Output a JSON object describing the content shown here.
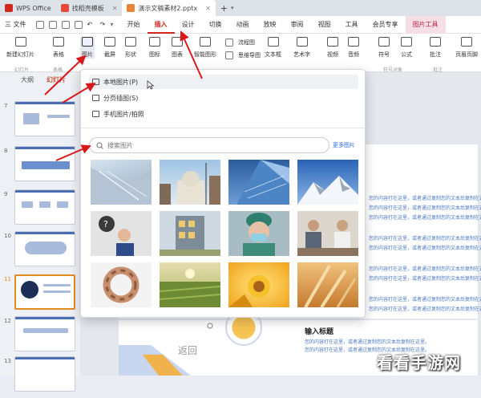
{
  "titlebar": {
    "tabs": [
      {
        "label": "WPS Office",
        "color": "#d0261d"
      },
      {
        "label": "找稻壳模板",
        "color": "#e8483b"
      },
      {
        "label": "演示文稿素材2.pptx",
        "color": "#e8833a"
      }
    ],
    "new_tab": "+"
  },
  "menubar": {
    "file": "三 文件",
    "items": [
      "开始",
      "插入",
      "设计",
      "切换",
      "动画",
      "放映",
      "审阅",
      "视图",
      "工具",
      "会员专享",
      "图片工具"
    ],
    "active": "插入"
  },
  "ribbon": {
    "buttons": [
      {
        "label": "新建幻灯片"
      },
      {
        "label": "表格"
      },
      {
        "label": "图片"
      },
      {
        "label": "截屏"
      },
      {
        "label": "形状"
      },
      {
        "label": "图标"
      },
      {
        "label": "图表"
      },
      {
        "label": "智能图形"
      },
      {
        "label": "流程图"
      },
      {
        "label": "思维导图"
      },
      {
        "label": "文本框"
      },
      {
        "label": "艺术字"
      },
      {
        "label": "视频"
      },
      {
        "label": "音频"
      },
      {
        "label": "符号"
      },
      {
        "label": "公式"
      },
      {
        "label": "批注"
      },
      {
        "label": "页眉页脚"
      }
    ],
    "groups": [
      "幻灯片",
      "表格",
      "符号对象",
      "批注"
    ]
  },
  "sidebar": {
    "tabs": [
      "大纲",
      "幻灯片"
    ],
    "slides": [
      "7",
      "8",
      "9",
      "10",
      "11",
      "12",
      "13"
    ]
  },
  "popup": {
    "menu": [
      "本地图片(P)",
      "分页插图(S)",
      "手机图片/拍照"
    ],
    "search_placeholder": "搜索图片",
    "more_link": "更多图片",
    "images": [
      "architecture-icon",
      "cathedral-icon",
      "skyscraper-icon",
      "mountains-icon",
      "question-girl-icon",
      "building-icon",
      "doctor-mask-icon",
      "meeting-icon",
      "hands-circle-icon",
      "field-sunset-icon",
      "sunflower-icon",
      "wheat-icon"
    ]
  },
  "slide": {
    "heading": "输入标题",
    "line1": "您的内容打在这里，或者通过复制您的文本后复制在这里。",
    "line2": "您的内容打在这里，或者通过复制您的文本后复制在这里。",
    "back_label": "返回"
  },
  "watermark": "看看手游网"
}
